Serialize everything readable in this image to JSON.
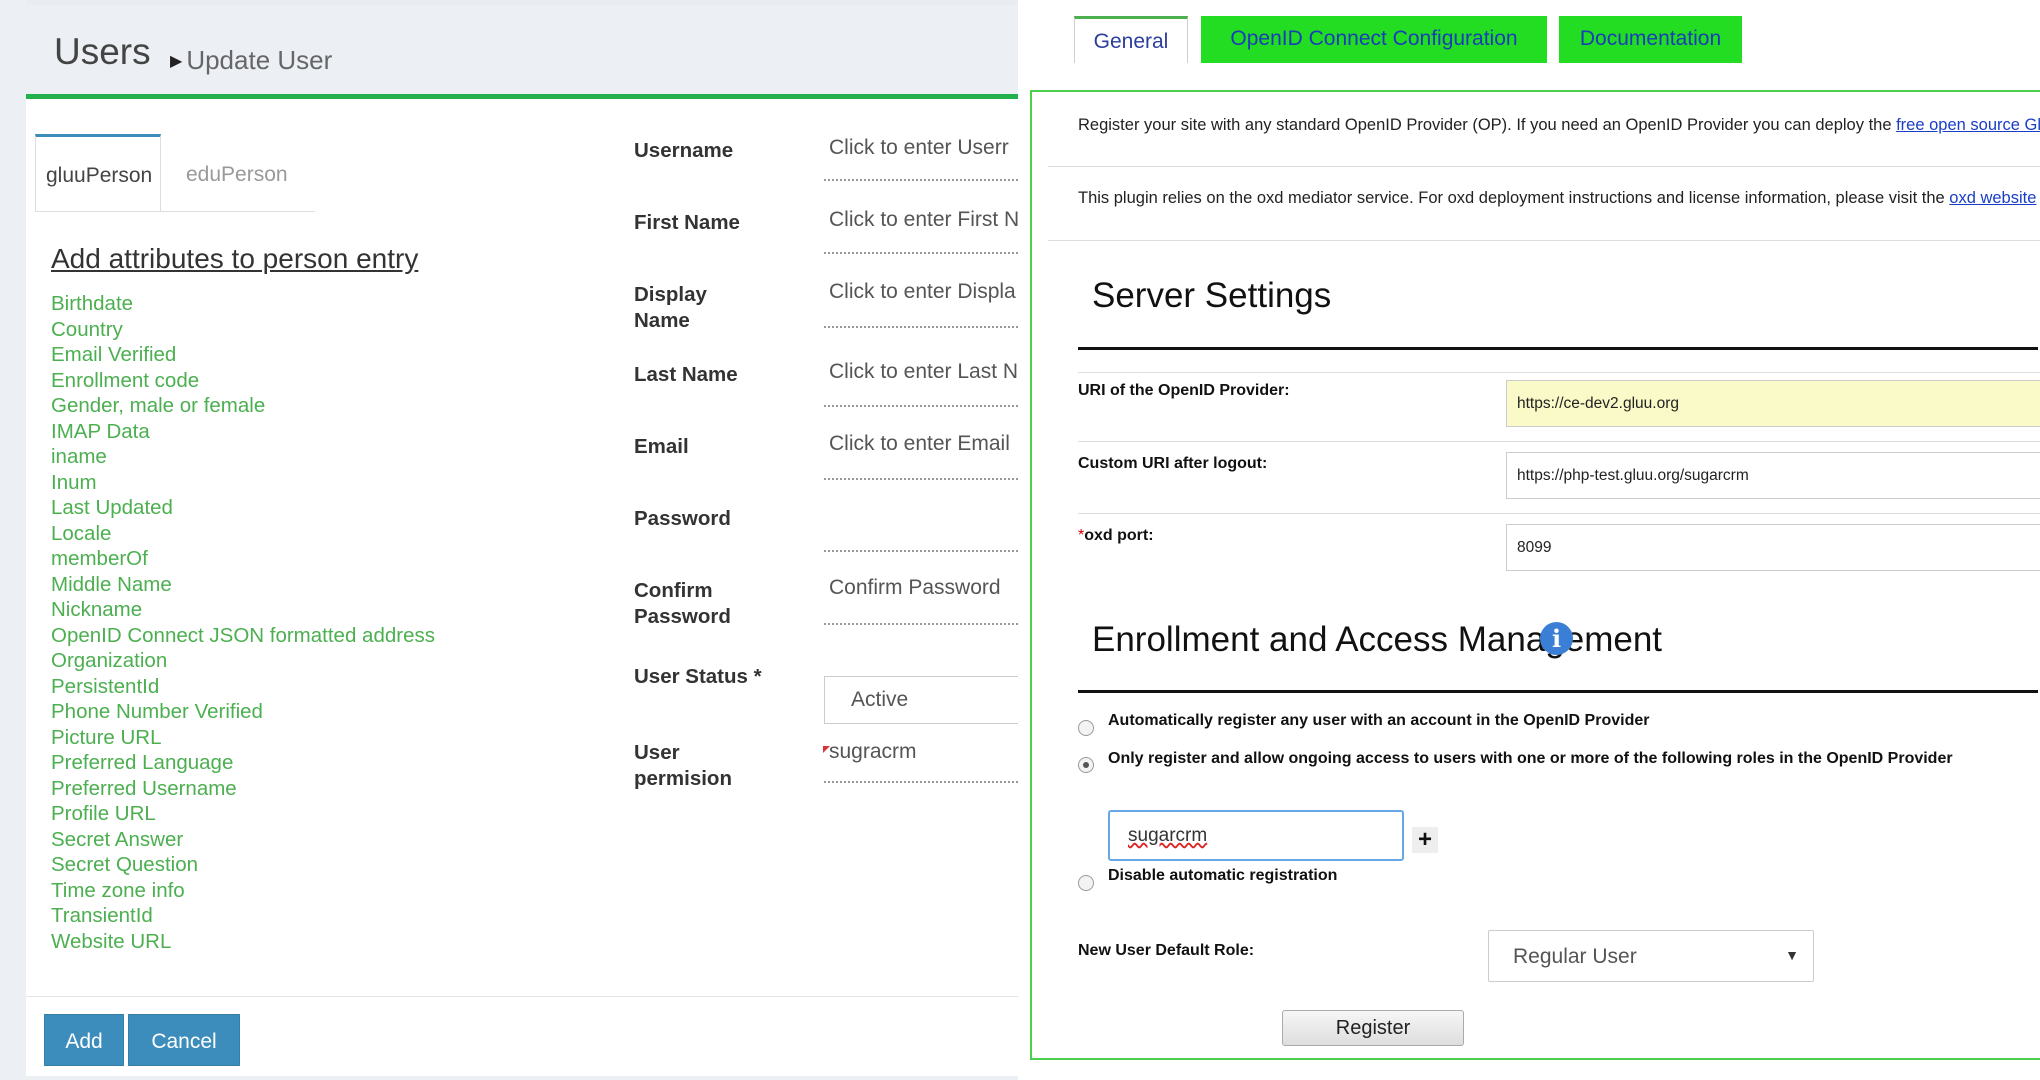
{
  "left": {
    "title": "Users",
    "subtitle": "Update User",
    "tabs": [
      "gluuPerson",
      "eduPerson"
    ],
    "attributes_heading": "Add attributes to person entry",
    "attributes": [
      "Birthdate",
      "Country",
      "Email Verified",
      "Enrollment code",
      "Gender, male or female",
      "IMAP Data",
      "iname",
      "Inum",
      "Last Updated",
      "Locale",
      "memberOf",
      "Middle Name",
      "Nickname",
      "OpenID Connect JSON formatted address",
      "Organization",
      "PersistentId",
      "Phone Number Verified",
      "Picture URL",
      "Preferred Language",
      "Preferred Username",
      "Profile URL",
      "Secret Answer",
      "Secret Question",
      "Time zone info",
      "TransientId",
      "Website URL"
    ],
    "form": {
      "username": {
        "label": "Username",
        "value": "Click to enter Userr"
      },
      "first_name": {
        "label": "First Name",
        "value": "Click to enter First N"
      },
      "display_name": {
        "label_1": "Display",
        "label_2": "Name",
        "value": "Click to enter Displa"
      },
      "last_name": {
        "label": "Last Name",
        "value": "Click to enter Last N"
      },
      "email": {
        "label": "Email",
        "value": "Click to enter Email"
      },
      "password": {
        "label": "Password",
        "value": ""
      },
      "confirm_password": {
        "label_1": "Confirm",
        "label_2": "Password",
        "value": "Confirm Password"
      },
      "user_status": {
        "label": "User Status *",
        "value": "Active"
      },
      "user_permission": {
        "label_1": "User",
        "label_2": "permision",
        "value": "sugracrm"
      }
    },
    "buttons": {
      "add": "Add",
      "cancel": "Cancel"
    }
  },
  "right": {
    "tabs": [
      "General",
      "OpenID Connect Configuration",
      "Documentation"
    ],
    "notice_1": {
      "text": "Register your site with any standard OpenID Provider (OP). If you need an OpenID Provider you can deploy the ",
      "link": "free open source Gluu Server"
    },
    "notice_2": {
      "text": "This plugin relies on the oxd mediator service. For oxd deployment instructions and license information, please visit the ",
      "link": "oxd website"
    },
    "server_settings": {
      "heading": "Server Settings",
      "provider_uri": {
        "label": "URI of the OpenID Provider:",
        "value": "https://ce-dev2.gluu.org"
      },
      "logout_uri": {
        "label": "Custom URI after logout:",
        "value": "https://php-test.gluu.org/sugarcrm"
      },
      "oxd_port": {
        "required_mark": "*",
        "label": "oxd port:",
        "value": "8099"
      }
    },
    "enrollment": {
      "heading": "Enrollment and Access Management",
      "info_icon": "i",
      "options": [
        {
          "label": "Automatically register any user with an account in the OpenID Provider",
          "checked": false
        },
        {
          "label": "Only register and allow ongoing access to users with one or more of the following roles in the OpenID Provider",
          "checked": true
        },
        {
          "label": "Disable automatic registration",
          "checked": false
        }
      ],
      "role_value": "sugarcrm",
      "add_symbol": "+",
      "default_role": {
        "label": "New User Default Role:",
        "value": "Regular User",
        "arrow": "▼"
      },
      "register_label": "Register"
    },
    "colors": {
      "tab_active_border": "#4caf50",
      "tab_green": "#22dd22",
      "panel_border": "#4cd04c",
      "link": "#1a3dc8"
    }
  },
  "colors": {
    "header_bar": "#22b14c",
    "attribute_text": "#4caf50",
    "button_blue": "#3c8dbc"
  }
}
